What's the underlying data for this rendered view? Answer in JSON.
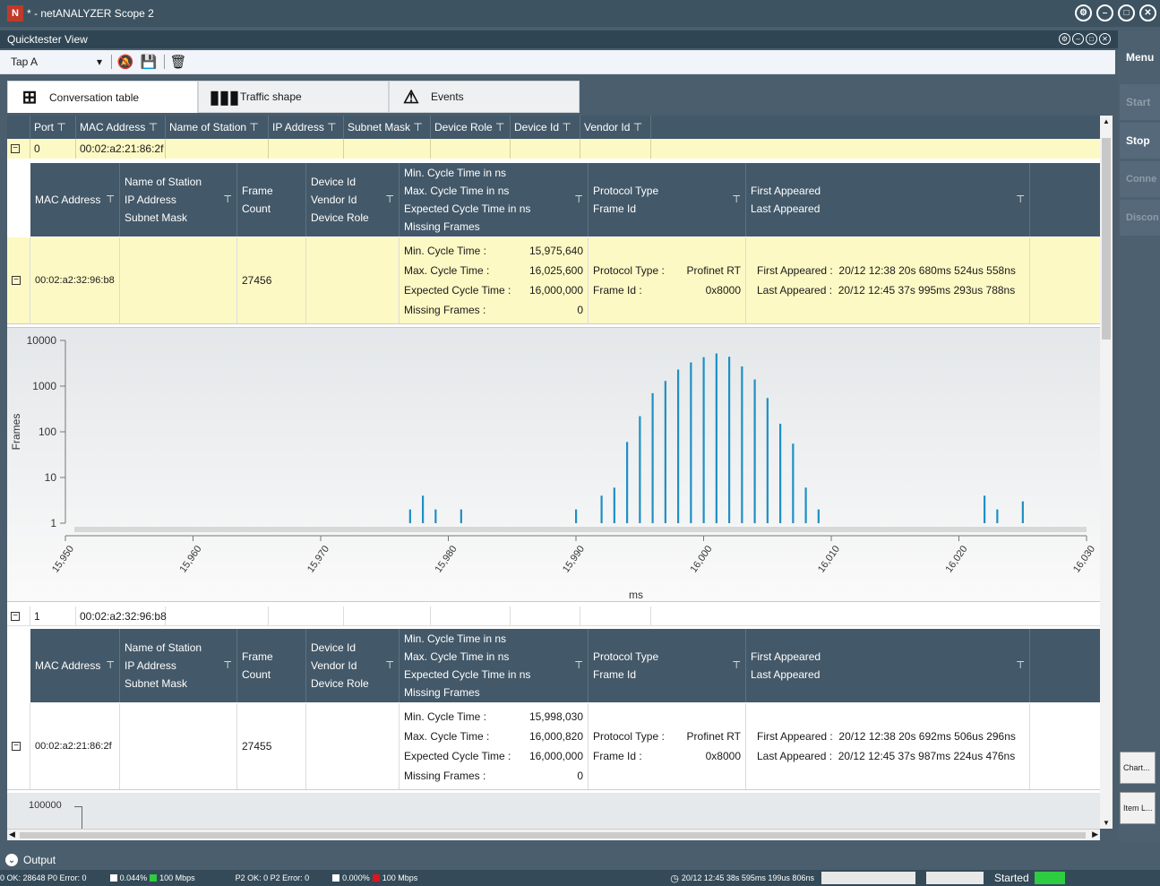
{
  "app": {
    "title": "* - netANALYZER Scope 2"
  },
  "quicktester": {
    "title": "Quicktester View"
  },
  "toolbar": {
    "tap_value": "Tap A",
    "icons": [
      "bell-off-icon",
      "save-icon",
      "clear-icon"
    ]
  },
  "tabs": [
    {
      "label": "Conversation table",
      "icon": "network-icon",
      "active": true
    },
    {
      "label": "Traffic shape",
      "icon": "bar-chart-icon",
      "active": false
    },
    {
      "label": "Events",
      "icon": "warning-icon",
      "active": false
    }
  ],
  "table": {
    "columns": [
      "Port",
      "MAC Address",
      "Name of Station",
      "IP Address",
      "Subnet Mask",
      "Device Role",
      "Device Id",
      "Vendor Id"
    ],
    "groups": [
      {
        "port": "0",
        "mac": "00:02:a2:21:86:2f"
      },
      {
        "port": "1",
        "mac": "00:02:a2:32:96:b8"
      }
    ]
  },
  "subheader": {
    "mac": "MAC Address",
    "station": [
      "Name of Station",
      "IP Address",
      "Subnet Mask"
    ],
    "frame_count": "Frame Count",
    "device": [
      "Device Id",
      "Vendor Id",
      "Device Role"
    ],
    "cycle": [
      "Min. Cycle Time  in ns",
      "Max. Cycle Time  in ns",
      "Expected Cycle Time  in ns",
      "Missing Frames"
    ],
    "protocol": [
      "Protocol Type",
      "Frame Id"
    ],
    "appeared": [
      "First Appeared",
      "Last Appeared"
    ]
  },
  "details": [
    {
      "mac": "00:02:a2:32:96:b8",
      "frame_count": "27456",
      "min_label": "Min. Cycle Time :",
      "min_value": "15,975,640",
      "max_label": "Max. Cycle Time :",
      "max_value": "16,025,600",
      "exp_label": "Expected Cycle Time :",
      "exp_value": "16,000,000",
      "miss_label": "Missing Frames :",
      "miss_value": "0",
      "protocol_label": "Protocol Type :",
      "protocol_value": "Profinet RT",
      "frameid_label": "Frame Id :",
      "frameid_value": "0x8000",
      "first_label": "First Appeared :",
      "first_value": "20/12 12:38 20s 680ms 524us 558ns",
      "last_label": "Last Appeared :",
      "last_value": "20/12 12:45 37s 995ms 293us 788ns"
    },
    {
      "mac": "00:02:a2:21:86:2f",
      "frame_count": "27455",
      "min_label": "Min. Cycle Time :",
      "min_value": "15,998,030",
      "max_label": "Max. Cycle Time :",
      "max_value": "16,000,820",
      "exp_label": "Expected Cycle Time :",
      "exp_value": "16,000,000",
      "miss_label": "Missing Frames :",
      "miss_value": "0",
      "protocol_label": "Protocol Type :",
      "protocol_value": "Profinet RT",
      "frameid_label": "Frame Id :",
      "frameid_value": "0x8000",
      "first_label": "First Appeared :",
      "first_value": "20/12 12:38 20s 692ms 506us 296ns",
      "last_label": "Last Appeared :",
      "last_value": "20/12 12:45 37s 987ms 224us 476ns"
    }
  ],
  "chart_data": {
    "type": "bar",
    "title": "",
    "xlabel": "ms",
    "ylabel": "Frames",
    "yscale": "log",
    "ylim": [
      1,
      10000
    ],
    "xlim": [
      15950,
      16030
    ],
    "yticks": [
      "10000",
      "1000",
      "100",
      "10",
      "1"
    ],
    "xticks": [
      "15,950",
      "15,960",
      "15,970",
      "15,980",
      "15,990",
      "16,000",
      "16,010",
      "16,020",
      "16,030"
    ],
    "x": [
      15977,
      15978,
      15979,
      15981,
      15990,
      15992,
      15993,
      15994,
      15995,
      15996,
      15997,
      15998,
      15999,
      16000,
      16001,
      16002,
      16003,
      16004,
      16005,
      16006,
      16007,
      16008,
      16009,
      16022,
      16023,
      16025
    ],
    "y": [
      2,
      4,
      2,
      2,
      2,
      4,
      6,
      60,
      220,
      700,
      1300,
      2300,
      3300,
      4300,
      5200,
      4400,
      2700,
      1400,
      550,
      150,
      55,
      6,
      2,
      4,
      2,
      3
    ]
  },
  "chart2": {
    "ytick_top": "100000"
  },
  "right_panel": {
    "menu": "Menu",
    "start": "Start",
    "stop": "Stop",
    "connect": "Conne",
    "disconnect": "Discon",
    "chart": "Chart...",
    "item": "Item L..."
  },
  "output": {
    "label": "Output"
  },
  "status": {
    "p0_ok": "0 OK:  28648  P0 Error:  0",
    "p0_load": "0.044%",
    "p0_speed": "100 Mbps",
    "p2_ok": "P2 OK:  0  P2 Error:  0",
    "p2_load": "0.000%",
    "p2_speed": "100 Mbps",
    "time": "20/12 12:45 38s 595ms 199us 806ns",
    "state": "Started",
    "colors": {
      "green": "#2ecc40",
      "red": "#e0141e",
      "white": "#ffffff"
    }
  }
}
